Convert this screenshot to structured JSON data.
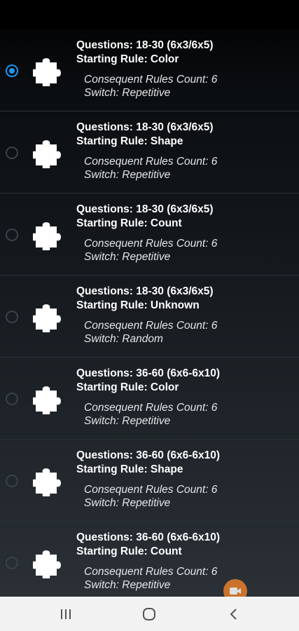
{
  "items": [
    {
      "questions": "Questions: 18-30 (6x3/6x5)",
      "rule": "Starting Rule: Color",
      "count": "Consequent Rules Count: 6",
      "switch": "Switch: Repetitive",
      "selected": true
    },
    {
      "questions": "Questions: 18-30 (6x3/6x5)",
      "rule": "Starting Rule: Shape",
      "count": "Consequent Rules Count: 6",
      "switch": "Switch: Repetitive",
      "selected": false
    },
    {
      "questions": "Questions: 18-30 (6x3/6x5)",
      "rule": "Starting Rule: Count",
      "count": "Consequent Rules Count: 6",
      "switch": "Switch: Repetitive",
      "selected": false
    },
    {
      "questions": "Questions: 18-30 (6x3/6x5)",
      "rule": "Starting Rule: Unknown",
      "count": "Consequent Rules Count: 6",
      "switch": "Switch: Random",
      "selected": false
    },
    {
      "questions": "Questions: 36-60 (6x6-6x10)",
      "rule": "Starting Rule: Color",
      "count": "Consequent Rules Count: 6",
      "switch": "Switch: Repetitive",
      "selected": false
    },
    {
      "questions": "Questions: 36-60 (6x6-6x10)",
      "rule": "Starting Rule: Shape",
      "count": "Consequent Rules Count: 6",
      "switch": "Switch: Repetitive",
      "selected": false
    },
    {
      "questions": "Questions: 36-60 (6x6-6x10)",
      "rule": "Starting Rule: Count",
      "count": "Consequent Rules Count: 6",
      "switch": "Switch: Repetitive",
      "selected": false
    }
  ],
  "icons": {
    "item_icon": "puzzle-piece-icon",
    "fab_icon": "video-camera-icon",
    "nav": [
      "recent-apps-icon",
      "home-icon",
      "back-icon"
    ]
  },
  "colors": {
    "accent": "#2196f3",
    "fab": "#e87f2b",
    "nav_bar": "#f2f2f2"
  }
}
